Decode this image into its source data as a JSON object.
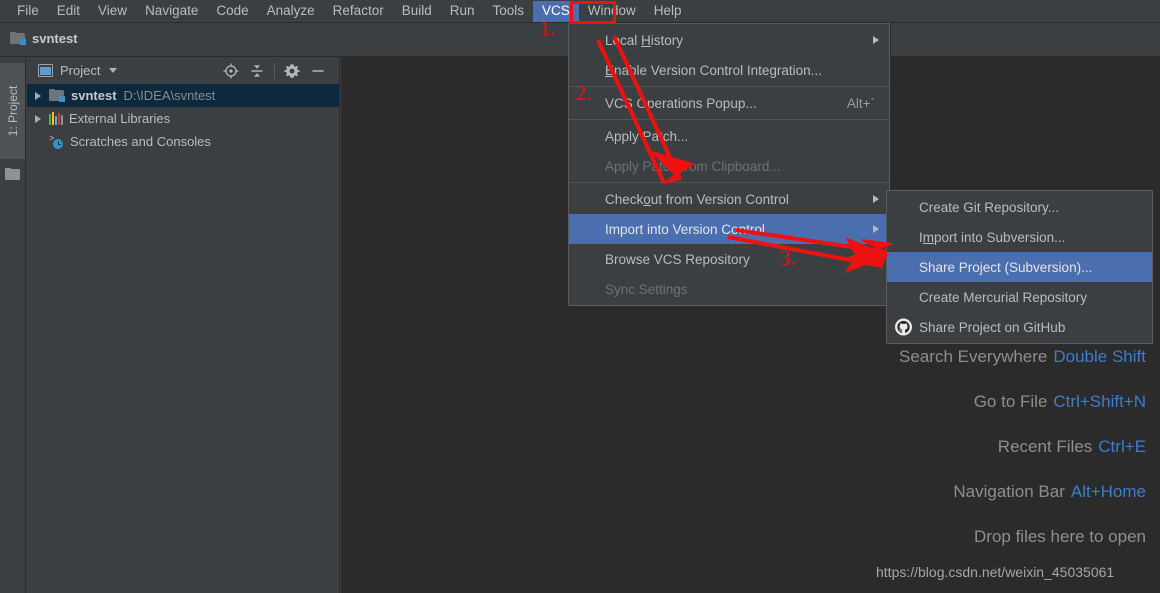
{
  "menubar": {
    "items": [
      {
        "label": "File",
        "mnemonic": "F",
        "active": false
      },
      {
        "label": "Edit",
        "mnemonic": "E",
        "active": false
      },
      {
        "label": "View",
        "mnemonic": "V",
        "active": false
      },
      {
        "label": "Navigate",
        "mnemonic": "N",
        "active": false
      },
      {
        "label": "Code",
        "mnemonic": "C",
        "active": false
      },
      {
        "label": "Analyze",
        "mnemonic": "z",
        "active": false
      },
      {
        "label": "Refactor",
        "mnemonic": "R",
        "active": false
      },
      {
        "label": "Build",
        "mnemonic": "B",
        "active": false
      },
      {
        "label": "Run",
        "mnemonic": "u",
        "active": false
      },
      {
        "label": "Tools",
        "mnemonic": "T",
        "active": false
      },
      {
        "label": "VCS",
        "mnemonic": "S",
        "active": true
      },
      {
        "label": "Window",
        "mnemonic": "W",
        "active": false
      },
      {
        "label": "Help",
        "mnemonic": "H",
        "active": false
      }
    ]
  },
  "titlebar": {
    "project_name": "svntest"
  },
  "left_stripe": {
    "project_tab": "1: Project"
  },
  "project_panel": {
    "title": "Project",
    "actions": [
      {
        "name": "locate-icon",
        "tooltip": "Select Opened File"
      },
      {
        "name": "collapse-all-icon",
        "tooltip": "Collapse All"
      },
      {
        "name": "gear-icon",
        "tooltip": "Settings"
      },
      {
        "name": "minimize-icon",
        "tooltip": "Hide"
      }
    ],
    "tree": [
      {
        "label": "svntest",
        "path": "D:\\IDEA\\svntest",
        "icon": "folder-icon",
        "expandable": true,
        "selected": true,
        "bold": true
      },
      {
        "label": "External Libraries",
        "path": "",
        "icon": "library-icon",
        "expandable": true,
        "selected": false,
        "bold": false
      },
      {
        "label": "Scratches and Consoles",
        "path": "",
        "icon": "scratches-icon",
        "expandable": false,
        "selected": false,
        "bold": false
      }
    ]
  },
  "vcs_menu": {
    "items": [
      {
        "label": "Local History",
        "pre": "Local ",
        "mnemonic": "H",
        "post": "istory",
        "accel": "",
        "submenu": true,
        "disabled": false,
        "highlight": false,
        "separator_after": false
      },
      {
        "label": "Enable Version Control Integration...",
        "pre": "",
        "mnemonic": "E",
        "post": "nable Version Control Integration...",
        "accel": "",
        "submenu": false,
        "disabled": false,
        "highlight": false,
        "separator_after": true
      },
      {
        "label": "VCS Operations Popup...",
        "pre": "VCS Operations Popup...",
        "mnemonic": "",
        "post": "",
        "accel": "Alt+`",
        "submenu": false,
        "disabled": false,
        "highlight": false,
        "separator_after": true
      },
      {
        "label": "Apply Patch...",
        "pre": "Apply Patch...",
        "mnemonic": "",
        "post": "",
        "accel": "",
        "submenu": false,
        "disabled": false,
        "highlight": false,
        "separator_after": false
      },
      {
        "label": "Apply Patch from Clipboard...",
        "pre": "Apply Patch from Clipboard...",
        "mnemonic": "",
        "post": "",
        "accel": "",
        "submenu": false,
        "disabled": true,
        "highlight": false,
        "separator_after": true
      },
      {
        "label": "Checkout from Version Control",
        "pre": "Check",
        "mnemonic": "o",
        "post": "ut from Version Control",
        "accel": "",
        "submenu": true,
        "disabled": false,
        "highlight": false,
        "separator_after": false
      },
      {
        "label": "Import into Version Control",
        "pre": "Import into Version Control",
        "mnemonic": "",
        "post": "",
        "accel": "",
        "submenu": true,
        "disabled": false,
        "highlight": true,
        "separator_after": false
      },
      {
        "label": "Browse VCS Repository",
        "pre": "Browse VCS Repository",
        "mnemonic": "",
        "post": "",
        "accel": "",
        "submenu": true,
        "disabled": false,
        "highlight": false,
        "separator_after": false
      },
      {
        "label": "Sync Settings",
        "pre": "Sync Settings",
        "mnemonic": "",
        "post": "",
        "accel": "",
        "submenu": false,
        "disabled": true,
        "highlight": false,
        "separator_after": false
      }
    ]
  },
  "import_submenu": {
    "items": [
      {
        "label": "Create Git Repository...",
        "pre": "Create Git Repository...",
        "mnemonic": "",
        "post": "",
        "icon": "",
        "highlight": false
      },
      {
        "label": "Import into Subversion...",
        "pre": "I",
        "mnemonic": "m",
        "post": "port into Subversion...",
        "icon": "",
        "highlight": false
      },
      {
        "label": "Share Project (Subversion)...",
        "pre": "Share Project (Subversion)...",
        "mnemonic": "",
        "post": "",
        "icon": "",
        "highlight": true
      },
      {
        "label": "Create Mercurial Repository",
        "pre": "Create Mercurial Repository",
        "mnemonic": "",
        "post": "",
        "icon": "",
        "highlight": false
      },
      {
        "label": "Share Project on GitHub",
        "pre": "Share Project on GitHub",
        "mnemonic": "",
        "post": "",
        "icon": "github-icon",
        "highlight": false
      }
    ]
  },
  "editor_tips": {
    "rows": [
      {
        "label": "Search Everywhere",
        "key": "Double Shift"
      },
      {
        "label": "Go to File",
        "key": "Ctrl+Shift+N"
      },
      {
        "label": "Recent Files",
        "key": "Ctrl+E"
      },
      {
        "label": "Navigation Bar",
        "key": "Alt+Home"
      },
      {
        "label": "Drop files here to open",
        "key": ""
      }
    ]
  },
  "watermark": {
    "text": "https://blog.csdn.net/weixin_45035061"
  },
  "annotations": {
    "step1": "1.",
    "step2": "2.",
    "step3": "3.",
    "color": "#ee1111"
  },
  "colors": {
    "accent_blue": "#4b6eaf",
    "panel_bg": "#3c3f41",
    "editor_bg": "#2b2b2b",
    "tree_selected": "#0d293e",
    "link_blue": "#3d7dcc",
    "annotation_red": "#ee1111"
  }
}
